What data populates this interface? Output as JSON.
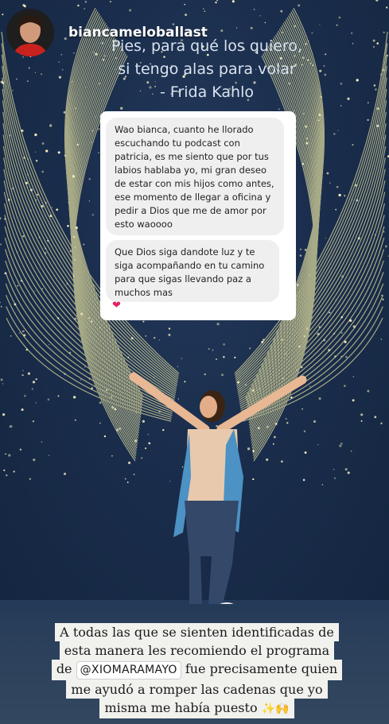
{
  "profile": {
    "username": "biancameloballast"
  },
  "wall_quote": {
    "line1": "Pies, para qué los quiero,",
    "line2": "si tengo alas para volar",
    "line3": "- Frida Kahlo"
  },
  "dm": {
    "message1": "Wao bianca, cuanto he llorado escuchando tu podcast con patricia, es me siento que por tus labios hablaba yo, mi gran deseo de estar con mis hijos como antes, ese momento de llegar a oficina y pedir a Dios que me de amor por esto waoooo",
    "message2": "Que Dios siga dandote luz y te siga acompañando en tu camino para que sigas llevando paz a muchos mas",
    "reaction": "❤"
  },
  "caption": {
    "line1": "A todas las que se sienten identificadas de",
    "line2": "esta manera les recomiendo el programa",
    "line3_before": "de",
    "mention": "@XIOMARAMAYO",
    "line3_after": "fue precisamente quien",
    "line4": "me ayudó a romper las cadenas que yo",
    "line5": "misma me había puesto",
    "line5_emoji": "✨🙌"
  },
  "colors": {
    "wall": "#1a2d4c",
    "lights": "#f4e9a8",
    "caption_bg": "#f1f1ee",
    "dm_bubble": "#efefef"
  }
}
